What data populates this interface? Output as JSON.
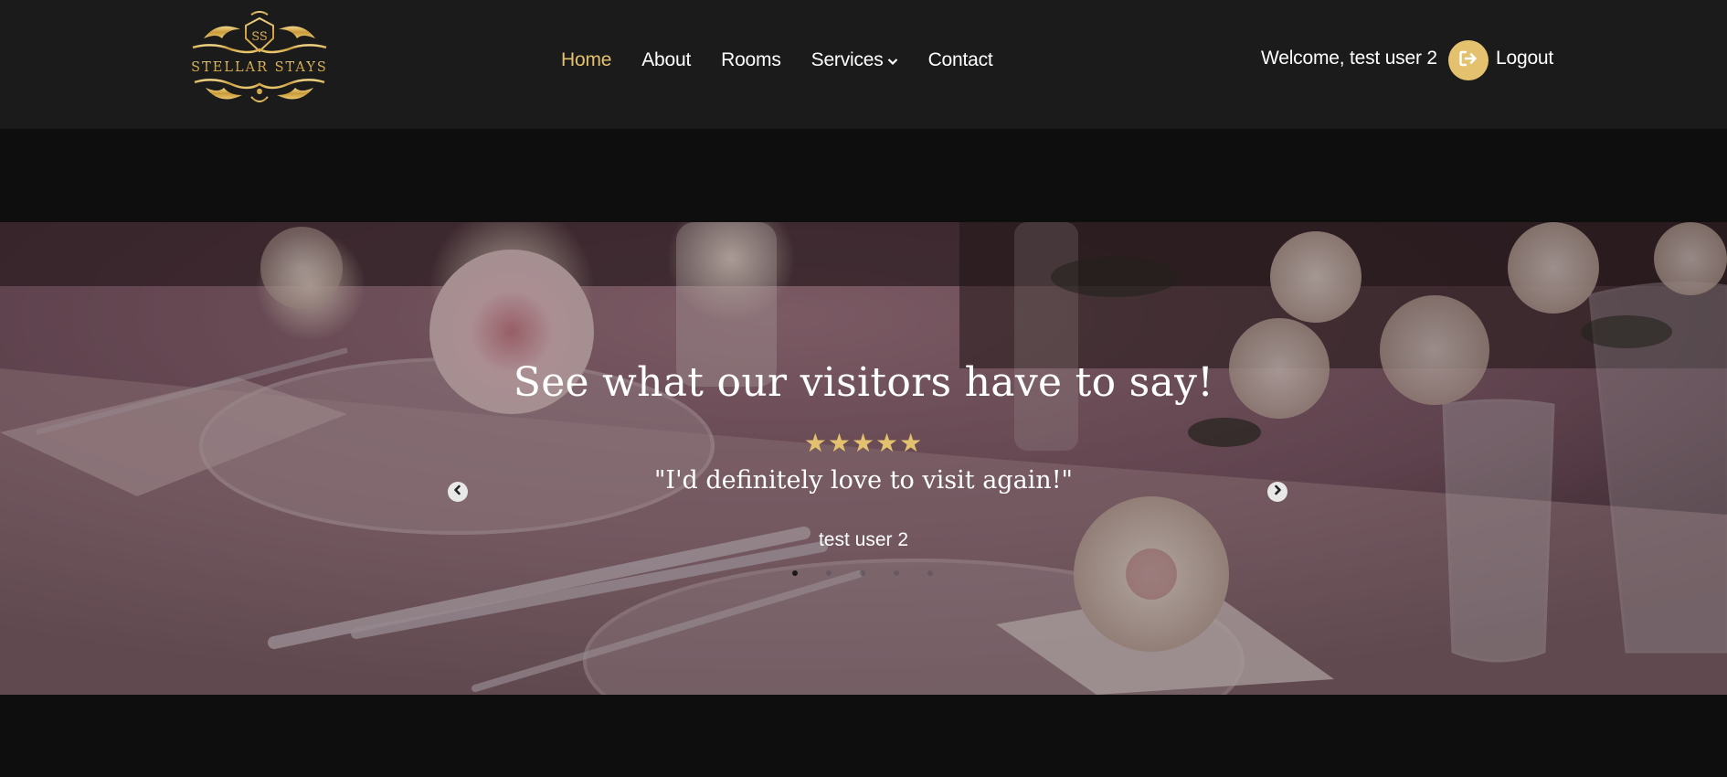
{
  "brand": {
    "name": "STELLAR STAYS",
    "monogram": "SS",
    "logo_color": "#d4ac4d"
  },
  "nav": {
    "items": [
      {
        "label": "Home",
        "active": true
      },
      {
        "label": "About",
        "active": false
      },
      {
        "label": "Rooms",
        "active": false
      },
      {
        "label": "Services",
        "active": false,
        "has_dropdown": true
      },
      {
        "label": "Contact",
        "active": false
      }
    ]
  },
  "user": {
    "welcome": "Welcome, test user 2",
    "logout_label": "Logout",
    "logout_icon": "logout-arrow-icon"
  },
  "testimonials": {
    "title": "See what our visitors have to say!",
    "stars": "★★★★★",
    "rating": 5,
    "quote": "\"I'd definitely love to visit again!\"",
    "reviewer": "test user 2",
    "slide_count": 5,
    "active_slide": 1,
    "prev_icon": "chevron-left-circle-icon",
    "next_icon": "chevron-right-circle-icon"
  },
  "colors": {
    "accent": "#e3c16f",
    "header_bg": "#1b1b1b",
    "page_bg": "#0e0e0e"
  }
}
